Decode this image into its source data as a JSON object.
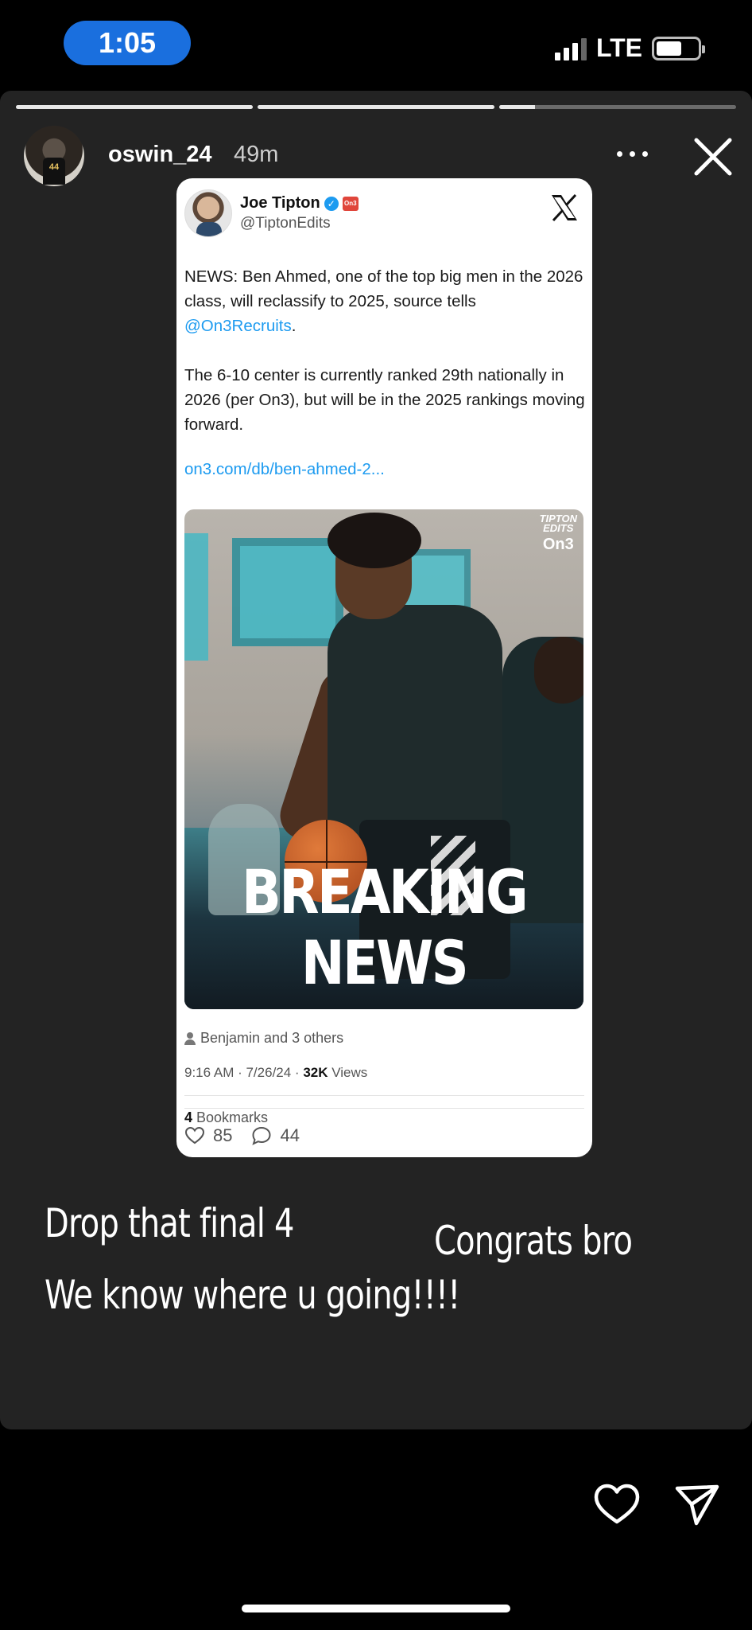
{
  "status_bar": {
    "time": "1:05",
    "network": "LTE"
  },
  "story": {
    "username": "oswin_24",
    "posted_ago": "49m",
    "progress_segments": [
      1.0,
      1.0,
      0.15
    ],
    "captions": [
      "Drop that final 4",
      "We know where u going!!!!",
      "Congrats bro"
    ]
  },
  "tweet": {
    "author_name": "Joe Tipton",
    "author_handle": "@TiptonEdits",
    "org_badge": "On3",
    "avatar_jersey": "44",
    "text_1_pre": "NEWS: Ben Ahmed, one of the top big men in the 2026 class, will reclassify to 2025, source tells ",
    "text_1_mention": "@On3Recruits",
    "text_1_post": ".",
    "text_2": "The 6-10 center is currently ranked 29th nationally in 2026 (per On3), but will be in the 2025 rankings moving forward.",
    "link": "on3.com/db/ben-ahmed-2...",
    "media_watermark_line1": "TIPTON",
    "media_watermark_line2": "EDITS",
    "media_watermark_brand": "On3",
    "media_headline": "BREAKING NEWS",
    "liked_by": "Benjamin and 3 others",
    "timestamp": "9:16 AM · 7/26/24 · ",
    "views_count": "32K",
    "views_label": " Views",
    "bookmarks_count": "4",
    "bookmarks_label": " Bookmarks",
    "likes": "85",
    "replies": "44"
  },
  "colors": {
    "time_pill": "#1a6fde",
    "link": "#1d9bf0",
    "story_bg": "#232323"
  }
}
